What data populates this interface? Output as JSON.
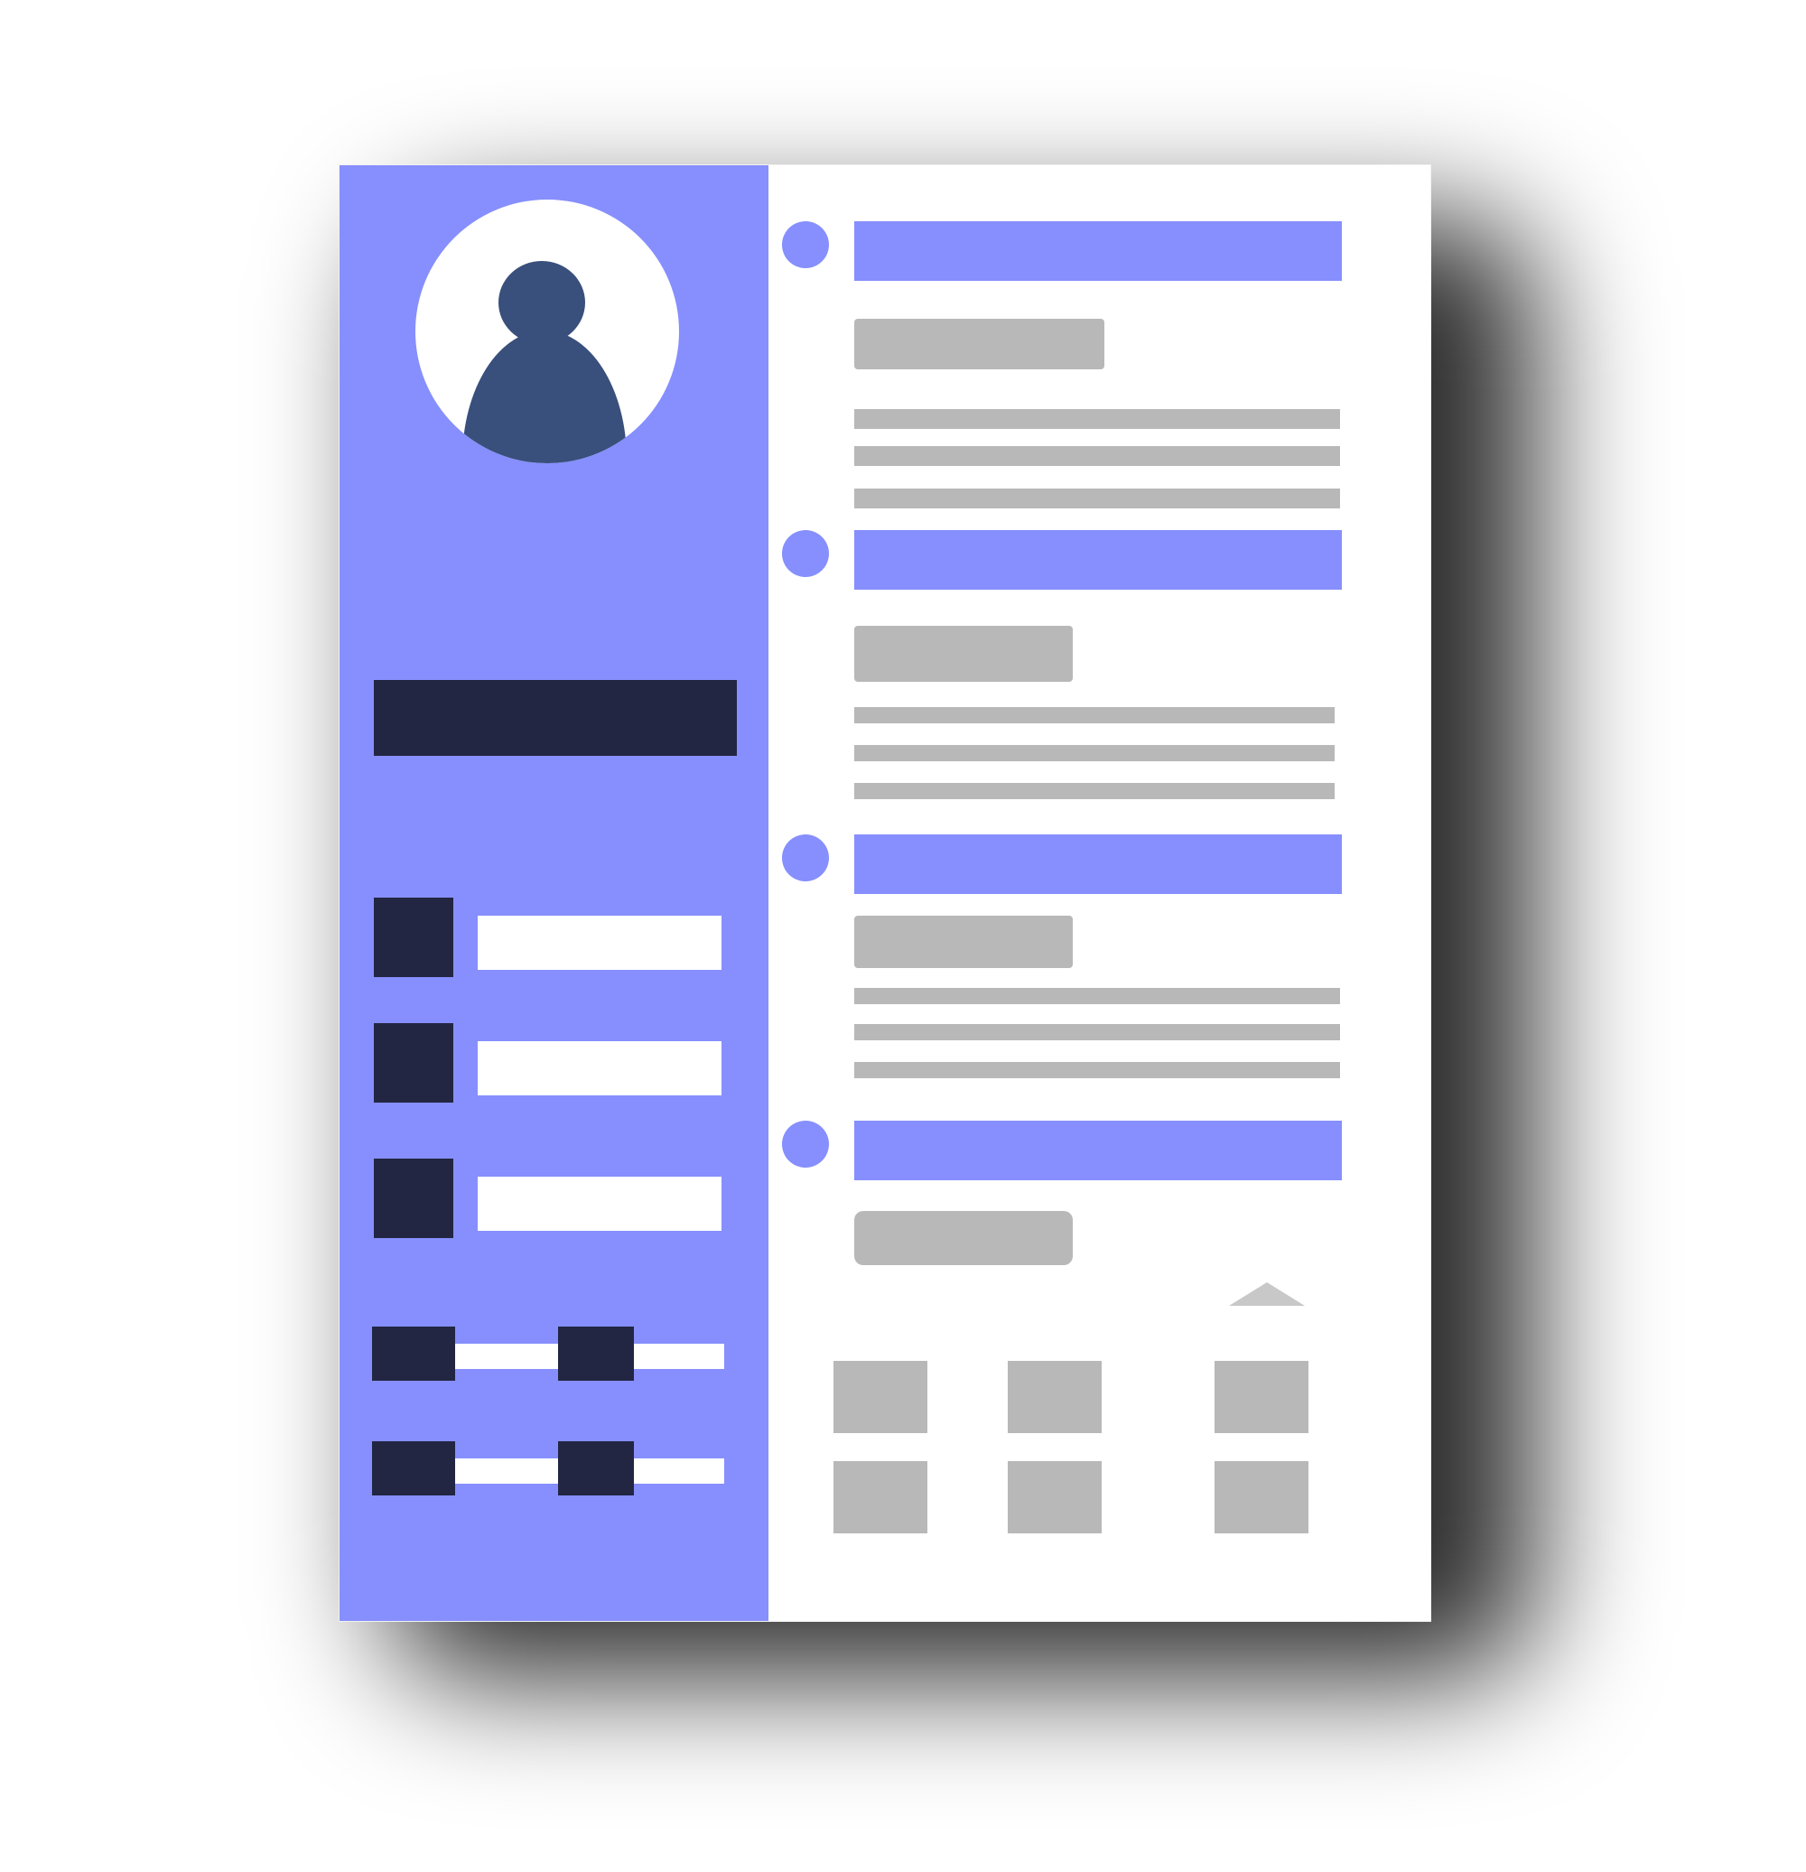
{
  "colors": {
    "accent": "#868ffd",
    "navy": "#222642",
    "dark_blue": "#394f7c",
    "gray": "#b8b8b8",
    "shadow": "#000000"
  },
  "sidebar": {
    "avatar_icon": "person-silhouette",
    "skill_rows": 3,
    "slider_rows": 2
  },
  "main": {
    "sections": 4
  },
  "grid": {
    "rows": 2,
    "cols": 3
  }
}
